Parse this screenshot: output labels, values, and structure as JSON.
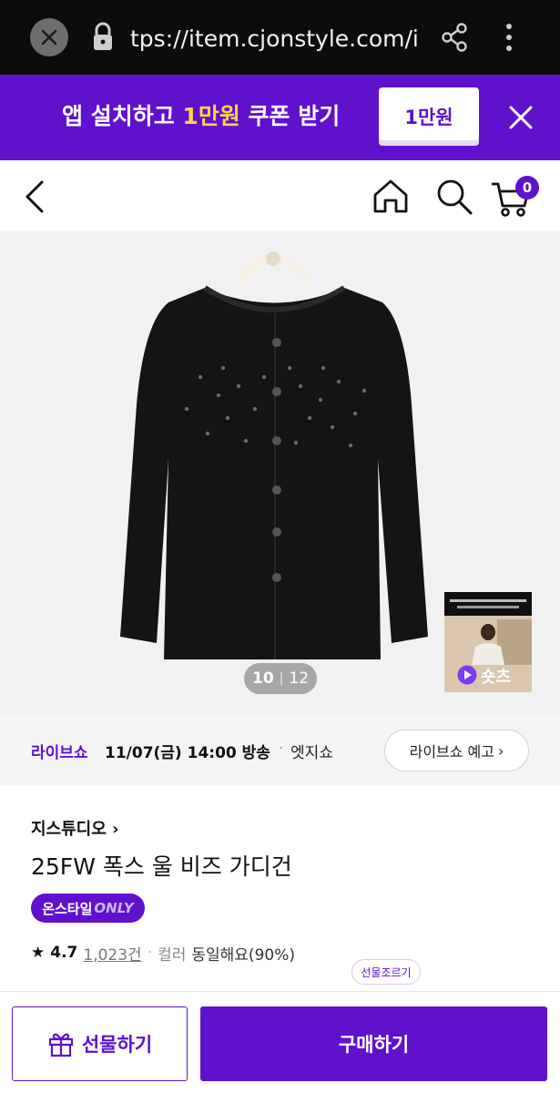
{
  "browser": {
    "url": "tps://item.cjonstyle.com/i",
    "close_icon": "close-icon",
    "lock_icon": "lock-icon",
    "share_icon": "share-icon",
    "menu_icon": "menu-icon"
  },
  "app_banner": {
    "text_prefix": "앱 설치하고 ",
    "text_highlight": "1만원",
    "text_suffix": " 쿠폰 받기",
    "coupon_label": "1만원",
    "close_icon": "close-icon"
  },
  "header": {
    "back_icon": "back-icon",
    "home_icon": "home-icon",
    "search_icon": "search-icon",
    "cart_icon": "cart-icon",
    "cart_count": "0"
  },
  "gallery": {
    "current": "10",
    "separator": "|",
    "total": "12",
    "shorts_label": "숏츠"
  },
  "live": {
    "label": "라이브쇼",
    "datetime": "11/07(금) 14:00 방송",
    "separator": "·",
    "brand": "엣지쇼",
    "button_label": "라이브쇼 예고",
    "button_chevron": "›"
  },
  "product": {
    "brand": "지스튜디오",
    "brand_chevron": "›",
    "title": "25FW 폭스 울 비즈 가디건",
    "badge_prefix": "온스타일",
    "badge_only": "ONLY",
    "rating": "4.7",
    "review_count": "1,023건",
    "attr_separator": "·",
    "attr_label": "컬러",
    "attr_value": "동일해요(90%)",
    "gift_tip": "선물조르기"
  },
  "bottom_bar": {
    "gift_label": "선물하기",
    "buy_label": "구매하기"
  },
  "colors": {
    "brand_purple": "#6011cc",
    "banner_highlight": "#ffd24a"
  }
}
